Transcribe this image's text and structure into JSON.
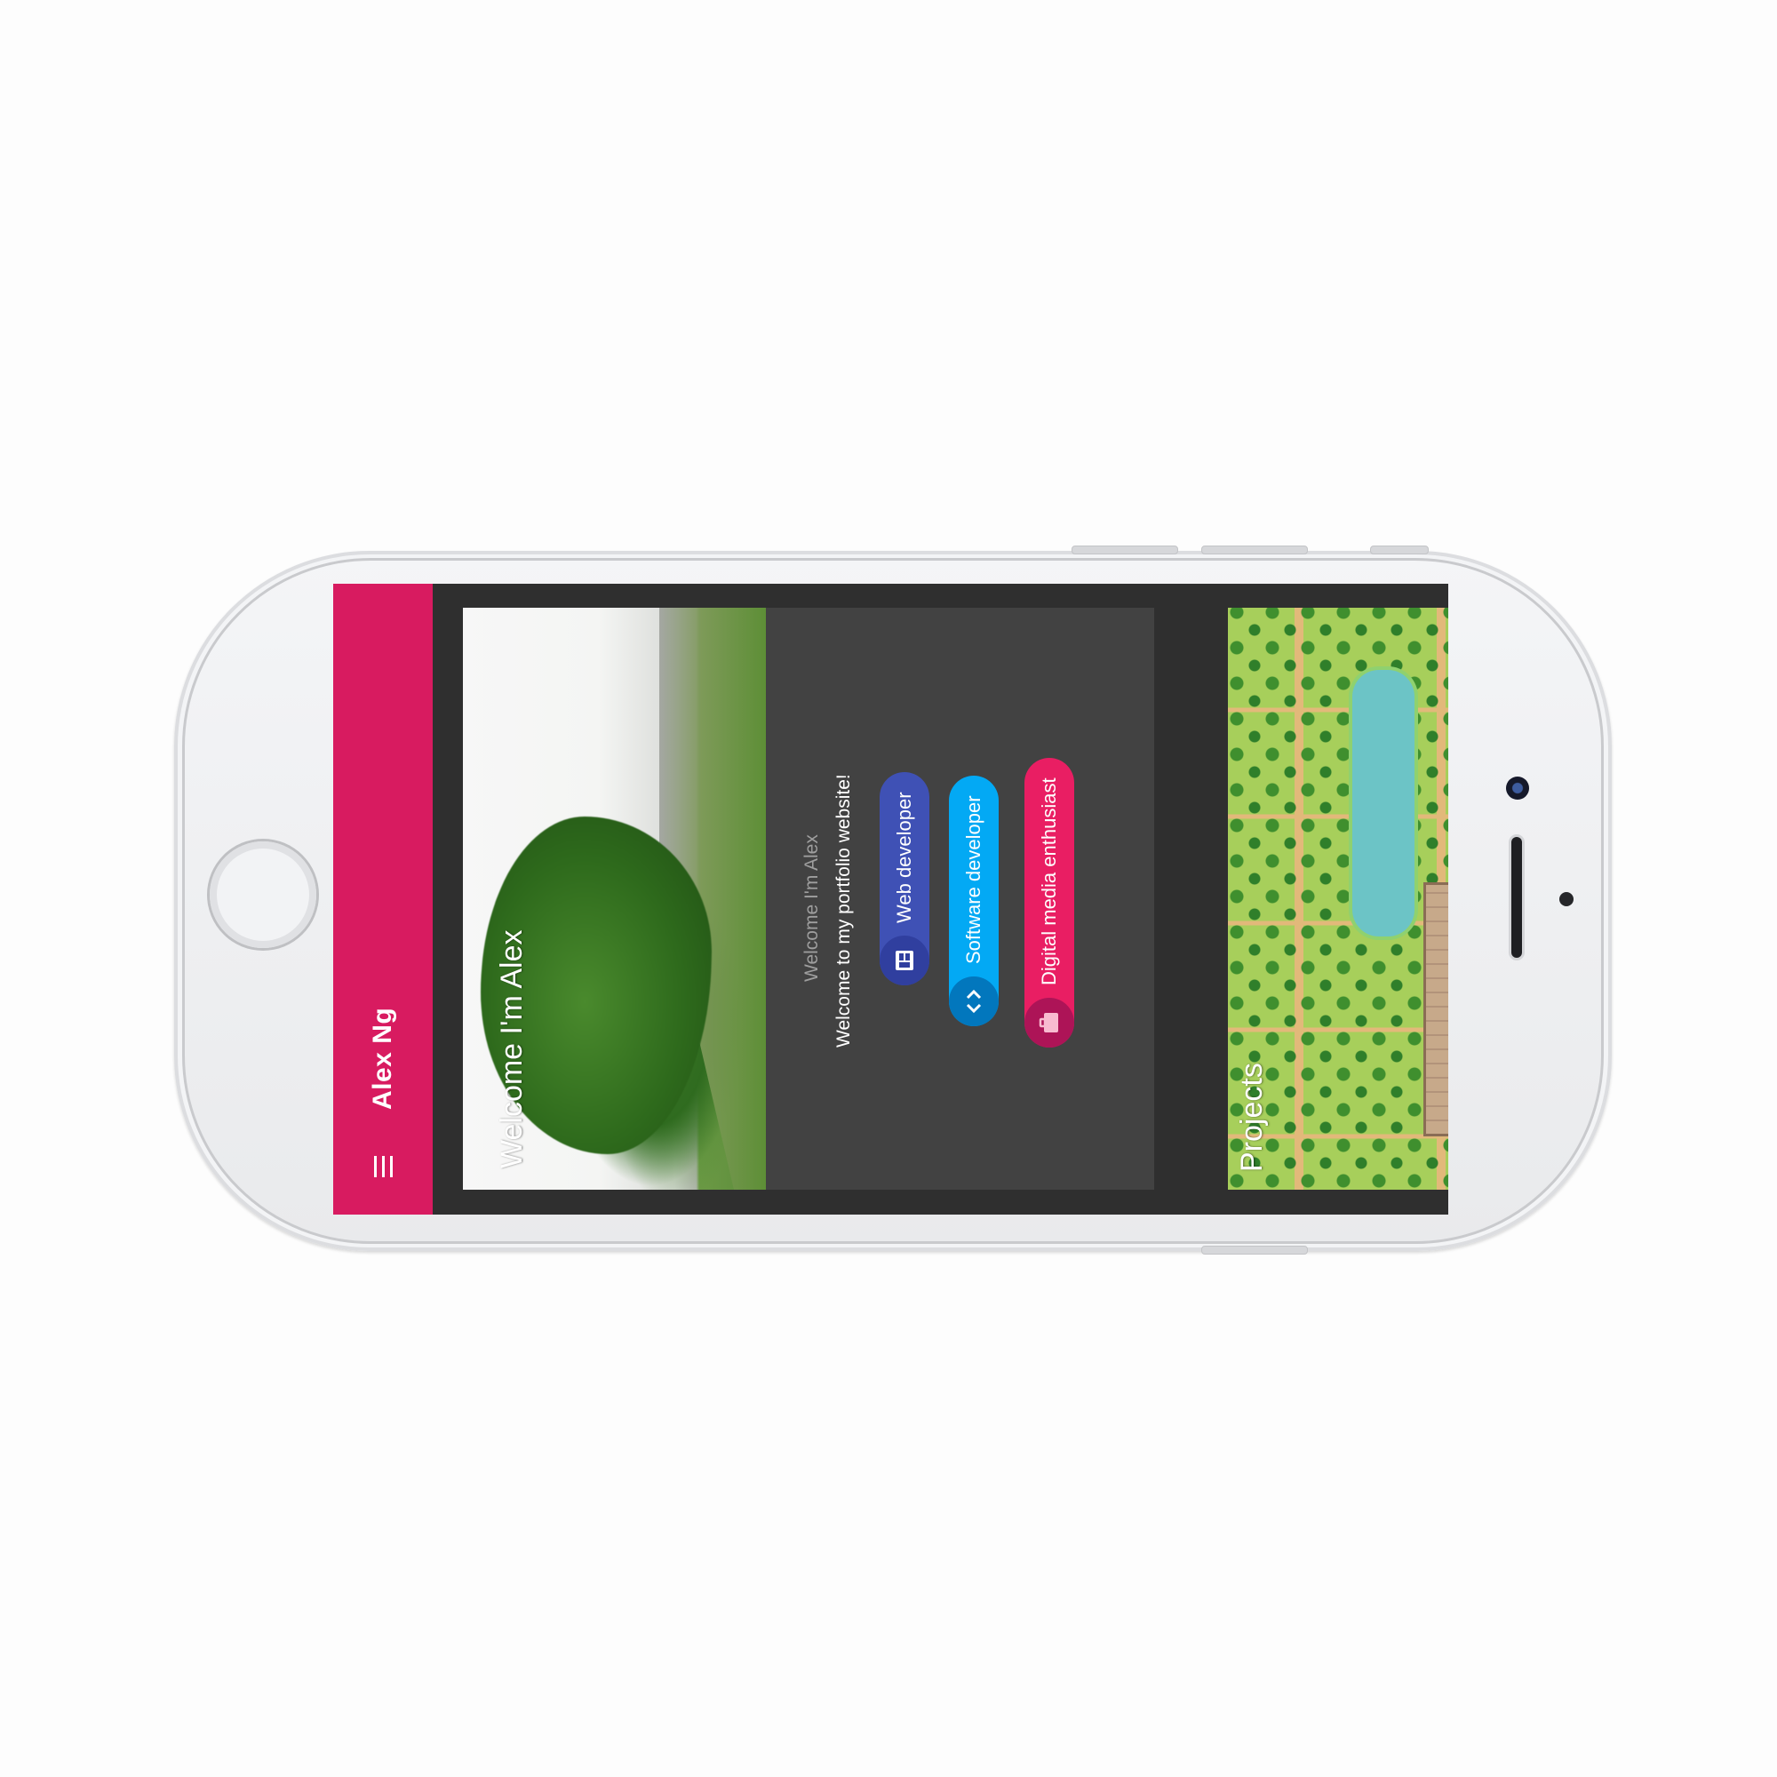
{
  "app": {
    "title": "Alex Ng",
    "accent_color": "#d81b60",
    "menu_icon": "menu-icon"
  },
  "hero": {
    "title": "Welcome I'm Alex"
  },
  "about": {
    "title": "Welcome I'm Alex",
    "subtitle": "Welcome to my portfolio website!",
    "chips": [
      {
        "label": "Web developer",
        "icon": "web-icon",
        "color": "#3f51b5"
      },
      {
        "label": "Software developer",
        "icon": "code-icon",
        "color": "#03a9f4"
      },
      {
        "label": "Digital media enthusiast",
        "icon": "briefcase-icon",
        "color": "#e91e63"
      }
    ]
  },
  "projects": {
    "title": "Projects"
  }
}
